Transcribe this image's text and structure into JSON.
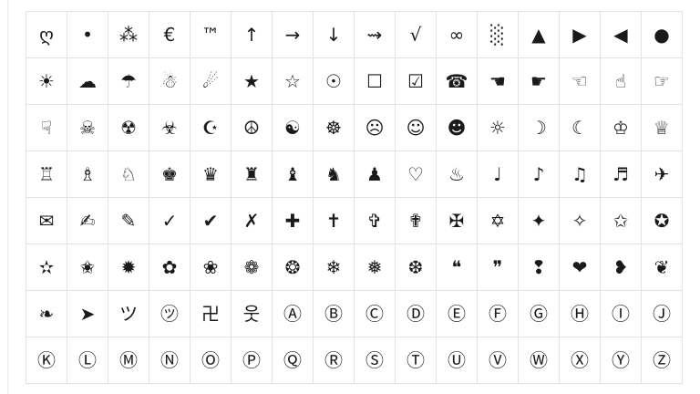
{
  "symbol_grid": {
    "rows": [
      {
        "cells": [
          {
            "symbol": "ღ",
            "icon": "cursive-heart-icon"
          },
          {
            "symbol": "•",
            "icon": "bullet-icon"
          },
          {
            "symbol": "⁂",
            "icon": "asterism-icon"
          },
          {
            "symbol": "€",
            "icon": "euro-sign-icon"
          },
          {
            "symbol": "™",
            "icon": "trademark-icon"
          },
          {
            "symbol": "↑",
            "icon": "arrow-up-icon"
          },
          {
            "symbol": "→",
            "icon": "arrow-right-icon"
          },
          {
            "symbol": "↓",
            "icon": "arrow-down-icon"
          },
          {
            "symbol": "⇝",
            "icon": "squiggle-arrow-icon"
          },
          {
            "symbol": "√",
            "icon": "square-root-icon"
          },
          {
            "symbol": "∞",
            "icon": "infinity-icon"
          },
          {
            "symbol": "░",
            "icon": "light-shade-icon"
          },
          {
            "symbol": "▲",
            "icon": "triangle-up-icon"
          },
          {
            "symbol": "▶",
            "icon": "triangle-right-icon"
          },
          {
            "symbol": "◀",
            "icon": "triangle-left-icon"
          },
          {
            "symbol": "●",
            "icon": "black-circle-icon"
          }
        ]
      },
      {
        "cells": [
          {
            "symbol": "☀",
            "icon": "sun-icon"
          },
          {
            "symbol": "☁",
            "icon": "cloud-icon"
          },
          {
            "symbol": "☂",
            "icon": "umbrella-icon"
          },
          {
            "symbol": "☃",
            "icon": "snowman-icon"
          },
          {
            "symbol": "☄",
            "icon": "comet-icon"
          },
          {
            "symbol": "★",
            "icon": "black-star-icon"
          },
          {
            "symbol": "☆",
            "icon": "white-star-icon"
          },
          {
            "symbol": "☉",
            "icon": "sun-symbol-icon"
          },
          {
            "symbol": "☐",
            "icon": "ballot-box-icon"
          },
          {
            "symbol": "☑",
            "icon": "ballot-box-check-icon"
          },
          {
            "symbol": "☎",
            "icon": "telephone-icon"
          },
          {
            "symbol": "☚",
            "icon": "hand-left-icon"
          },
          {
            "symbol": "☛",
            "icon": "hand-right-icon"
          },
          {
            "symbol": "☜",
            "icon": "white-hand-left-icon"
          },
          {
            "symbol": "☝",
            "icon": "hand-up-icon"
          },
          {
            "symbol": "☞",
            "icon": "white-hand-right-icon"
          }
        ]
      },
      {
        "cells": [
          {
            "symbol": "☟",
            "icon": "hand-down-icon"
          },
          {
            "symbol": "☠",
            "icon": "skull-crossbones-icon"
          },
          {
            "symbol": "☢",
            "icon": "radioactive-icon"
          },
          {
            "symbol": "☣",
            "icon": "biohazard-icon"
          },
          {
            "symbol": "☪",
            "icon": "star-crescent-icon"
          },
          {
            "symbol": "☮",
            "icon": "peace-icon"
          },
          {
            "symbol": "☯",
            "icon": "yin-yang-icon"
          },
          {
            "symbol": "☸",
            "icon": "dharma-wheel-icon"
          },
          {
            "symbol": "☹",
            "icon": "frowning-face-icon"
          },
          {
            "symbol": "☺",
            "icon": "smiling-face-icon"
          },
          {
            "symbol": "☻",
            "icon": "black-smiling-face-icon"
          },
          {
            "symbol": "☼",
            "icon": "sun-rays-icon"
          },
          {
            "symbol": "☽",
            "icon": "first-quarter-moon-icon"
          },
          {
            "symbol": "☾",
            "icon": "last-quarter-moon-icon"
          },
          {
            "symbol": "♔",
            "icon": "white-king-icon"
          },
          {
            "symbol": "♕",
            "icon": "white-queen-icon"
          }
        ]
      },
      {
        "cells": [
          {
            "symbol": "♖",
            "icon": "white-rook-icon"
          },
          {
            "symbol": "♗",
            "icon": "white-bishop-icon"
          },
          {
            "symbol": "♘",
            "icon": "white-knight-icon"
          },
          {
            "symbol": "♚",
            "icon": "black-king-icon"
          },
          {
            "symbol": "♛",
            "icon": "black-queen-icon"
          },
          {
            "symbol": "♜",
            "icon": "black-rook-icon"
          },
          {
            "symbol": "♝",
            "icon": "black-bishop-icon"
          },
          {
            "symbol": "♞",
            "icon": "black-knight-icon"
          },
          {
            "symbol": "♟",
            "icon": "black-pawn-icon"
          },
          {
            "symbol": "♡",
            "icon": "white-heart-icon"
          },
          {
            "symbol": "♨",
            "icon": "hot-springs-icon"
          },
          {
            "symbol": "♩",
            "icon": "quarter-note-icon"
          },
          {
            "symbol": "♪",
            "icon": "eighth-note-icon"
          },
          {
            "symbol": "♫",
            "icon": "beamed-eighth-notes-icon"
          },
          {
            "symbol": "♬",
            "icon": "beamed-sixteenth-notes-icon"
          },
          {
            "symbol": "✈",
            "icon": "airplane-icon"
          }
        ]
      },
      {
        "cells": [
          {
            "symbol": "✉",
            "icon": "envelope-icon"
          },
          {
            "symbol": "✍",
            "icon": "writing-hand-icon"
          },
          {
            "symbol": "✎",
            "icon": "pencil-icon"
          },
          {
            "symbol": "✓",
            "icon": "check-mark-icon"
          },
          {
            "symbol": "✔",
            "icon": "heavy-check-mark-icon"
          },
          {
            "symbol": "✗",
            "icon": "ballot-x-icon"
          },
          {
            "symbol": "✚",
            "icon": "heavy-plus-icon"
          },
          {
            "symbol": "✝",
            "icon": "latin-cross-icon"
          },
          {
            "symbol": "✞",
            "icon": "shadowed-cross-icon"
          },
          {
            "symbol": "✟",
            "icon": "outlined-cross-icon"
          },
          {
            "symbol": "✠",
            "icon": "maltese-cross-icon"
          },
          {
            "symbol": "✡",
            "icon": "star-of-david-icon"
          },
          {
            "symbol": "✦",
            "icon": "four-point-star-icon"
          },
          {
            "symbol": "✧",
            "icon": "white-four-point-star-icon"
          },
          {
            "symbol": "✩",
            "icon": "stress-outlined-star-icon"
          },
          {
            "symbol": "✪",
            "icon": "circled-star-icon"
          }
        ]
      },
      {
        "cells": [
          {
            "symbol": "✫",
            "icon": "open-centre-star-icon"
          },
          {
            "symbol": "✬",
            "icon": "black-centre-star-icon"
          },
          {
            "symbol": "✹",
            "icon": "twelve-point-star-icon"
          },
          {
            "symbol": "✿",
            "icon": "black-florette-icon"
          },
          {
            "symbol": "❀",
            "icon": "white-florette-icon"
          },
          {
            "symbol": "❁",
            "icon": "eight-petal-florette-icon"
          },
          {
            "symbol": "❂",
            "icon": "circled-open-star-icon"
          },
          {
            "symbol": "❄",
            "icon": "snowflake-icon"
          },
          {
            "symbol": "❅",
            "icon": "tight-snowflake-icon"
          },
          {
            "symbol": "❆",
            "icon": "heavy-snowflake-icon"
          },
          {
            "symbol": "❝",
            "icon": "left-quote-ornament-icon"
          },
          {
            "symbol": "❞",
            "icon": "right-quote-ornament-icon"
          },
          {
            "symbol": "❢",
            "icon": "heavy-exclamation-ornament-icon"
          },
          {
            "symbol": "❤",
            "icon": "heavy-heart-icon"
          },
          {
            "symbol": "❥",
            "icon": "rotated-heart-icon"
          },
          {
            "symbol": "❦",
            "icon": "floral-heart-icon"
          }
        ]
      },
      {
        "cells": [
          {
            "symbol": "❧",
            "icon": "rotated-floral-heart-icon"
          },
          {
            "symbol": "➤",
            "icon": "arrowhead-icon"
          },
          {
            "symbol": "ツ",
            "icon": "katakana-tsu-icon"
          },
          {
            "symbol": "㋡",
            "icon": "circled-katakana-tsu-icon"
          },
          {
            "symbol": "卍",
            "icon": "swastika-character-icon"
          },
          {
            "symbol": "웃",
            "icon": "hangul-ut-icon"
          },
          {
            "symbol": "Ⓐ",
            "icon": "circled-a-icon"
          },
          {
            "symbol": "Ⓑ",
            "icon": "circled-b-icon"
          },
          {
            "symbol": "Ⓒ",
            "icon": "circled-c-icon"
          },
          {
            "symbol": "Ⓓ",
            "icon": "circled-d-icon"
          },
          {
            "symbol": "Ⓔ",
            "icon": "circled-e-icon"
          },
          {
            "symbol": "Ⓕ",
            "icon": "circled-f-icon"
          },
          {
            "symbol": "Ⓖ",
            "icon": "circled-g-icon"
          },
          {
            "symbol": "Ⓗ",
            "icon": "circled-h-icon"
          },
          {
            "symbol": "Ⓘ",
            "icon": "circled-i-icon"
          },
          {
            "symbol": "Ⓙ",
            "icon": "circled-j-icon"
          }
        ]
      },
      {
        "cells": [
          {
            "symbol": "Ⓚ",
            "icon": "circled-k-icon"
          },
          {
            "symbol": "Ⓛ",
            "icon": "circled-l-icon"
          },
          {
            "symbol": "Ⓜ",
            "icon": "circled-m-icon"
          },
          {
            "symbol": "Ⓝ",
            "icon": "circled-n-icon"
          },
          {
            "symbol": "Ⓞ",
            "icon": "circled-o-icon"
          },
          {
            "symbol": "Ⓟ",
            "icon": "circled-p-icon"
          },
          {
            "symbol": "Ⓠ",
            "icon": "circled-q-icon"
          },
          {
            "symbol": "Ⓡ",
            "icon": "circled-r-icon"
          },
          {
            "symbol": "Ⓢ",
            "icon": "circled-s-icon"
          },
          {
            "symbol": "Ⓣ",
            "icon": "circled-t-icon"
          },
          {
            "symbol": "Ⓤ",
            "icon": "circled-u-icon"
          },
          {
            "symbol": "Ⓥ",
            "icon": "circled-v-icon"
          },
          {
            "symbol": "Ⓦ",
            "icon": "circled-w-icon"
          },
          {
            "symbol": "Ⓧ",
            "icon": "circled-x-icon"
          },
          {
            "symbol": "Ⓨ",
            "icon": "circled-y-icon"
          },
          {
            "symbol": "Ⓩ",
            "icon": "circled-z-icon"
          }
        ]
      }
    ]
  }
}
